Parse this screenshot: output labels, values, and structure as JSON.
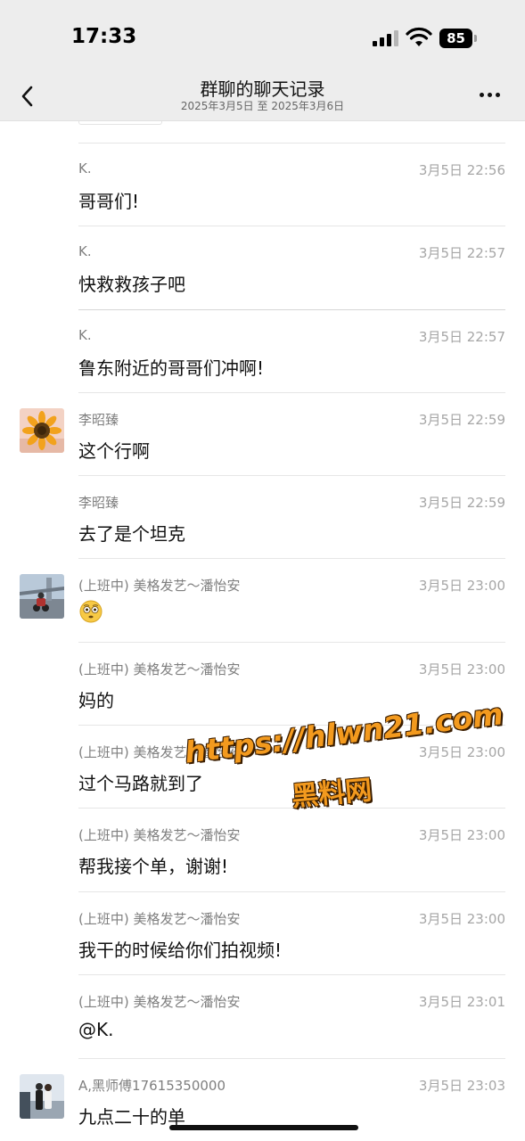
{
  "status_bar": {
    "time": "17:33",
    "battery": "85"
  },
  "nav": {
    "title": "群聊的聊天记录",
    "subtitle": "2025年3月5日 至 2025年3月6日"
  },
  "messages": [
    {
      "sender": "K.",
      "time": "3月5日 22:56",
      "text": "哥哥们!",
      "avatar": null
    },
    {
      "sender": "K.",
      "time": "3月5日 22:57",
      "text": "快救救孩子吧",
      "avatar": null
    },
    {
      "sender": "K.",
      "time": "3月5日 22:57",
      "text": "鲁东附近的哥哥们冲啊!",
      "avatar": null
    },
    {
      "sender": "李昭臻",
      "time": "3月5日 22:59",
      "text": "这个行啊",
      "avatar": "sunflower-avatar"
    },
    {
      "sender": "李昭臻",
      "time": "3月5日 22:59",
      "text": "去了是个坦克",
      "avatar": null
    },
    {
      "sender": "(上班中) 美格发艺～潘怡安",
      "time": "3月5日 23:00",
      "text": "",
      "emoji": "flushed-face-emoji",
      "avatar": "motorcycle-avatar"
    },
    {
      "sender": "(上班中) 美格发艺～潘怡安",
      "time": "3月5日 23:00",
      "text": "妈的",
      "avatar": null
    },
    {
      "sender": "(上班中) 美格发艺～潘怡安",
      "time": "3月5日 23:00",
      "text": "过个马路就到了",
      "avatar": null
    },
    {
      "sender": "(上班中) 美格发艺～潘怡安",
      "time": "3月5日 23:00",
      "text": "帮我接个单，谢谢!",
      "avatar": null
    },
    {
      "sender": "(上班中) 美格发艺～潘怡安",
      "time": "3月5日 23:00",
      "text": "我干的时候给你们拍视频!",
      "avatar": null
    },
    {
      "sender": "(上班中) 美格发艺～潘怡安",
      "time": "3月5日 23:01",
      "text": "@K.",
      "avatar": null
    },
    {
      "sender": "A,黑师傅17615350000",
      "time": "3月5日 23:03",
      "text": "九点二十的单",
      "avatar": "couple-photo-avatar"
    }
  ],
  "watermark": {
    "line1": "https://hlwn21.com",
    "line2": "黑料网"
  },
  "colors": {
    "header_bg": "#ededed",
    "watermark": "#f39a1e"
  }
}
